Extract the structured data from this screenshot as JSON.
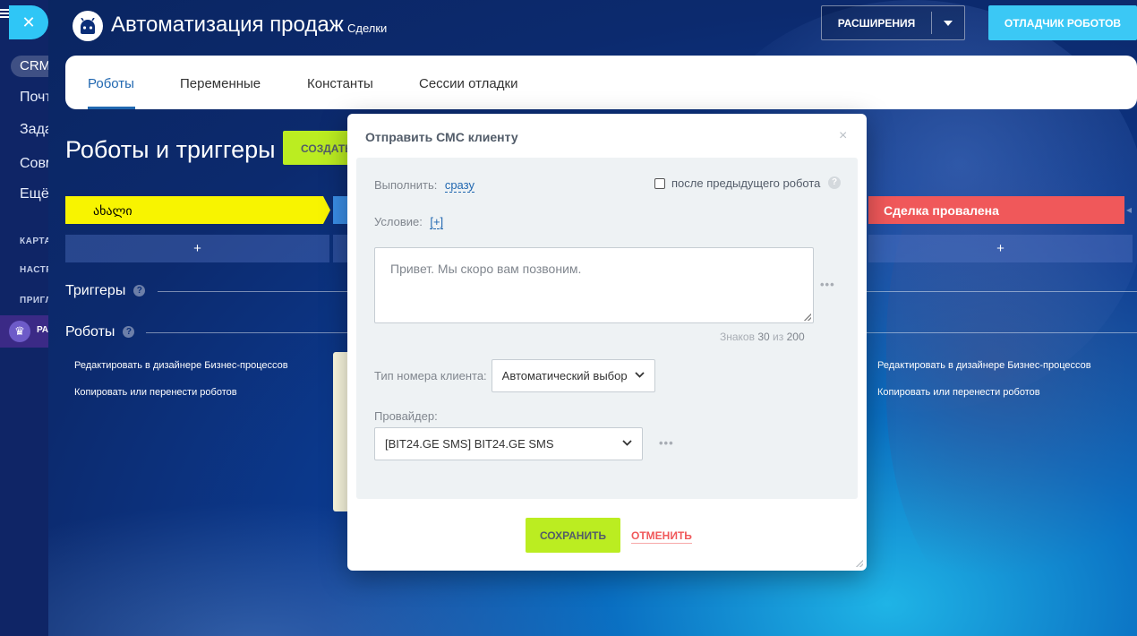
{
  "sidebar": {
    "crm_label": "CRM",
    "items": [
      "Почта",
      "Задачи",
      "Совместно",
      "Ещё"
    ],
    "sections": [
      "КАРТА",
      "НАСТРОЙКИ",
      "ПРИГЛАСИТЬ"
    ],
    "crown_label": "РА"
  },
  "header": {
    "title": "Автоматизация продаж",
    "subtitle": "Сделки",
    "extensions_button": "РАСШИРЕНИЯ",
    "debugger_button": "ОТЛАДЧИК РОБОТОВ"
  },
  "tabs": [
    {
      "label": "Роботы",
      "active": true
    },
    {
      "label": "Переменные",
      "active": false
    },
    {
      "label": "Константы",
      "active": false
    },
    {
      "label": "Сессии отладки",
      "active": false
    }
  ],
  "page": {
    "title": "Роботы и триггеры",
    "create_button": "СОЗДАТЬ",
    "stage_first": "ახალი",
    "stage_failed": "Сделка провалена",
    "add_symbol": "+",
    "triggers_label": "Триггеры",
    "robots_label": "Роботы",
    "help_symbol": "?",
    "links": {
      "edit_designer": "Редактировать в дизайнере Бизнес-процессов",
      "copy_move": "Копировать или перенести роботов"
    }
  },
  "modal": {
    "title": "Отправить СМС клиенту",
    "close_symbol": "×",
    "execute_label": "Выполнить:",
    "execute_value": "сразу",
    "after_previous_label": "после предыдущего робота",
    "after_previous_checked": false,
    "condition_label": "Условие:",
    "condition_value": "[+]",
    "message_text": "Привет. Мы скоро вам позвоним.",
    "more_dots": "•••",
    "counter": {
      "label": "Знаков",
      "count": "30",
      "of": "из",
      "max": "200"
    },
    "phone_type_label": "Тип номера клиента:",
    "phone_type_value": "Автоматический выбор",
    "provider_label": "Провайдер:",
    "provider_value": "[BIT24.GE SMS] BIT24.GE SMS",
    "save_button": "СОХРАНИТЬ",
    "cancel_button": "ОТМЕНИТЬ"
  },
  "colors": {
    "accent_blue": "#2067b0",
    "save_green": "#bbed21",
    "debugger_cyan": "#3bc8f5",
    "stage_yellow": "#f8f400",
    "stage_red": "#f0585a"
  }
}
